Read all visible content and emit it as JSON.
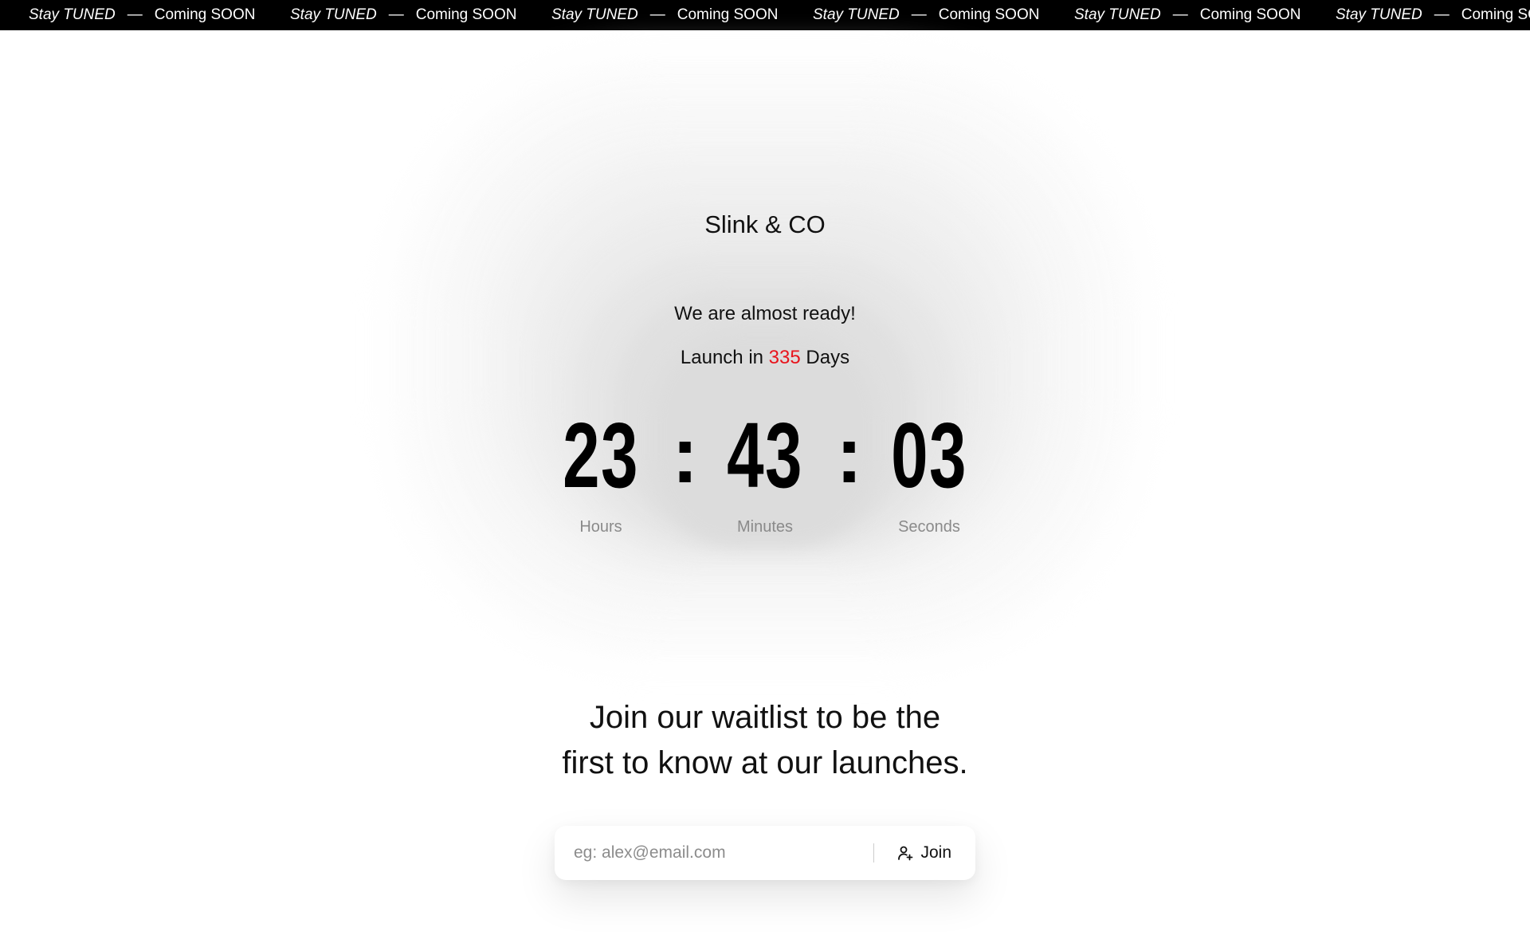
{
  "marquee": {
    "items": [
      {
        "stay": "Stay TUNED",
        "dash": "—",
        "coming": "Coming SOON"
      },
      {
        "stay": "Stay TUNED",
        "dash": "—",
        "coming": "Coming SOON"
      },
      {
        "stay": "Stay TUNED",
        "dash": "—",
        "coming": "Coming SOON"
      },
      {
        "stay": "Stay TUNED",
        "dash": "—",
        "coming": "Coming SOON"
      },
      {
        "stay": "Stay TUNED",
        "dash": "—",
        "coming": "Coming SOON"
      },
      {
        "stay": "Stay TUNED",
        "dash": "—",
        "coming": "Coming SOON"
      }
    ]
  },
  "brand": {
    "name": "Slink & CO"
  },
  "hero": {
    "tagline": "We are almost ready!",
    "launch_prefix": "Launch in",
    "days": "335",
    "launch_suffix": "Days"
  },
  "countdown": {
    "hours": "23",
    "minutes": "43",
    "seconds": "03",
    "separator": ":",
    "hours_label": "Hours",
    "minutes_label": "Minutes",
    "seconds_label": "Seconds"
  },
  "waitlist": {
    "line1": "Join our waitlist to be the",
    "line2": "first to know at our launches."
  },
  "form": {
    "email_placeholder": "eg: alex@email.com",
    "email_value": "",
    "join_label": "Join",
    "join_icon": "user-plus-icon"
  },
  "colors": {
    "marquee_bg": "#000000",
    "accent_days": "#e8141c",
    "label_gray": "#8a8a8a"
  }
}
